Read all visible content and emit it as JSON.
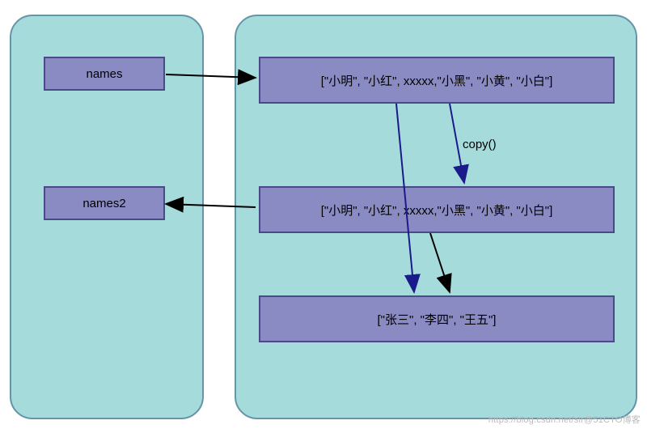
{
  "left": {
    "var1": "names",
    "var2": "names2"
  },
  "right": {
    "list1": "[\"小明\", \"小红\", xxxxx,\"小黑\", \"小黄\", \"小白\"]",
    "list2": "[\"小明\", \"小红\", xxxxx,\"小黑\", \"小黄\", \"小白\"]",
    "list3": "[\"张三\", \"李四\", \"王五\"]",
    "operation": "copy()"
  },
  "watermark": "https://blog.csdn.net/sir@51CTO博客",
  "chart_data": {
    "type": "diagram",
    "description": "Shallow copy illustration: names references list1; copy() produces list2; names2 references list2; both list1 and list2 share reference to nested list3.",
    "nodes": [
      {
        "id": "names",
        "label": "names",
        "kind": "variable"
      },
      {
        "id": "names2",
        "label": "names2",
        "kind": "variable"
      },
      {
        "id": "list1",
        "label": "[\"小明\", \"小红\", xxxxx,\"小黑\", \"小黄\", \"小白\"]",
        "kind": "list"
      },
      {
        "id": "list2",
        "label": "[\"小明\", \"小红\", xxxxx,\"小黑\", \"小黄\", \"小白\"]",
        "kind": "list"
      },
      {
        "id": "list3",
        "label": "[\"张三\", \"李四\", \"王五\"]",
        "kind": "list"
      }
    ],
    "edges": [
      {
        "from": "names",
        "to": "list1",
        "color": "black"
      },
      {
        "from": "list1",
        "to": "list2",
        "label": "copy()",
        "color": "navy"
      },
      {
        "from": "list2",
        "to": "names2",
        "color": "black"
      },
      {
        "from": "list1",
        "to": "list3",
        "color": "navy"
      },
      {
        "from": "list2",
        "to": "list3",
        "color": "black"
      }
    ]
  }
}
